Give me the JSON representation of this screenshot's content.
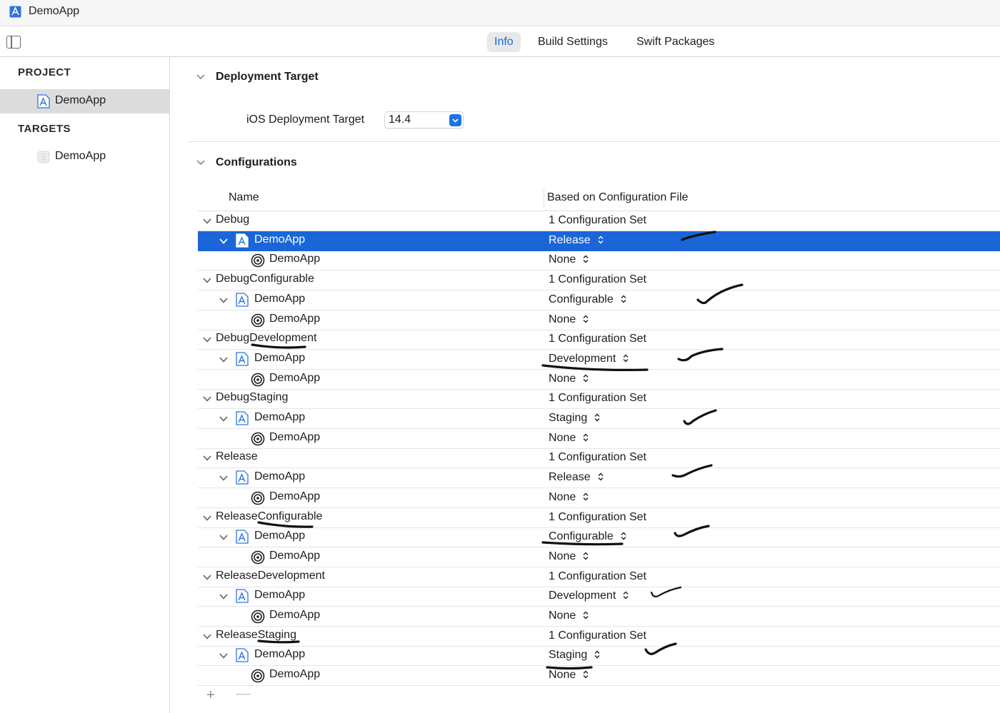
{
  "window": {
    "title": "DemoApp",
    "icon": "xcode-project-icon"
  },
  "tabs": [
    {
      "label": "Info",
      "active": true
    },
    {
      "label": "Build Settings",
      "active": false
    },
    {
      "label": "Swift Packages",
      "active": false
    }
  ],
  "sidebar": {
    "project_header": "PROJECT",
    "project_item": "DemoApp",
    "targets_header": "TARGETS",
    "target_item": "DemoApp"
  },
  "deployment": {
    "section_title": "Deployment Target",
    "field_label": "iOS Deployment Target",
    "value": "14.4"
  },
  "configurations": {
    "section_title": "Configurations",
    "columns": {
      "name": "Name",
      "based_on": "Based on Configuration File"
    },
    "groups": [
      {
        "name": "Debug",
        "summary": "1 Configuration Set",
        "project": "DemoApp",
        "project_value": "Release",
        "target": "DemoApp",
        "target_value": "None"
      },
      {
        "name": "DebugConfigurable",
        "summary": "1 Configuration Set",
        "project": "DemoApp",
        "project_value": "Configurable",
        "target": "DemoApp",
        "target_value": "None"
      },
      {
        "name": "DebugDevelopment",
        "summary": "1 Configuration Set",
        "project": "DemoApp",
        "project_value": "Development",
        "target": "DemoApp",
        "target_value": "None"
      },
      {
        "name": "DebugStaging",
        "summary": "1 Configuration Set",
        "project": "DemoApp",
        "project_value": "Staging",
        "target": "DemoApp",
        "target_value": "None"
      },
      {
        "name": "Release",
        "summary": "1 Configuration Set",
        "project": "DemoApp",
        "project_value": "Release",
        "target": "DemoApp",
        "target_value": "None"
      },
      {
        "name": "ReleaseConfigurable",
        "summary": "1 Configuration Set",
        "project": "DemoApp",
        "project_value": "Configurable",
        "target": "DemoApp",
        "target_value": "None"
      },
      {
        "name": "ReleaseDevelopment",
        "summary": "1 Configuration Set",
        "project": "DemoApp",
        "project_value": "Development",
        "target": "DemoApp",
        "target_value": "None"
      },
      {
        "name": "ReleaseStaging",
        "summary": "1 Configuration Set",
        "project": "DemoApp",
        "project_value": "Staging",
        "target": "DemoApp",
        "target_value": "None"
      }
    ],
    "footer": {
      "add": "+",
      "remove": "—"
    }
  },
  "colors": {
    "accent": "#1a66d9",
    "selected_row": "#1a66d9",
    "ink": "#111111"
  }
}
